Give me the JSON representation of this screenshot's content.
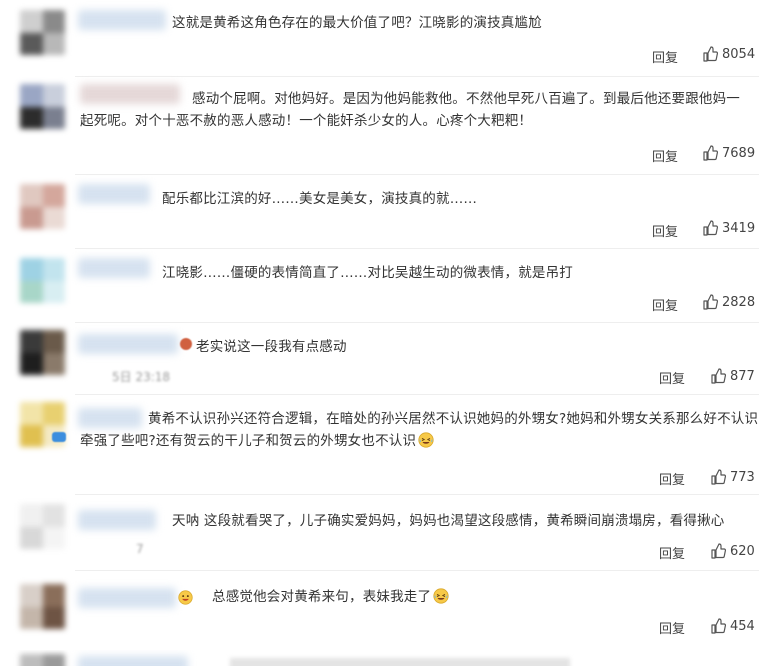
{
  "comments": [
    {
      "text": "这就是黄希这角色存在的最大价值了吧？江晓影的演技真尴尬",
      "reply_label": "回复",
      "likes": "8054"
    },
    {
      "text": "感动个屁啊。对他妈好。是因为他妈能救他。不然他早死八百遍了。到最后他还要跟他妈一起死呢。对个十恶不赦的恶人感动！一个能奸杀少女的人。心疼个大粑粑！",
      "reply_label": "回复",
      "likes": "7689"
    },
    {
      "text": "配乐都比江滨的好……美女是美女，演技真的就……",
      "reply_label": "回复",
      "likes": "3419"
    },
    {
      "text": "江晓影……僵硬的表情简直了……对比吴越生动的微表情，就是吊打",
      "reply_label": "回复",
      "likes": "2828"
    },
    {
      "text": "老实说这一段我有点感动",
      "time": "5日 23:18",
      "reply_label": "回复",
      "likes": "877"
    },
    {
      "text": "黄希不认识孙兴还符合逻辑，在暗处的孙兴居然不认识她妈的外甥女?她妈和外甥女关系那么好不认识牵强了些吧?还有贺云的干儿子和贺云的外甥女也不认识",
      "reply_label": "回复",
      "likes": "773"
    },
    {
      "text": "天呐 这段就看哭了，儿子确实爱妈妈，妈妈也渴望这段感情，黄希瞬间崩溃塌房，看得揪心",
      "time": "7",
      "reply_label": "回复",
      "likes": "620"
    },
    {
      "text": "总感觉他会对黄希来句，表妹我走了",
      "reply_label": "回复",
      "likes": "454"
    }
  ],
  "icons": {
    "like": "thumbs-up-icon",
    "laugh_emoji": "laughing-tears-emoji-icon",
    "grin_emoji": "grinning-emoji-icon"
  },
  "colors": {
    "text": "#333333",
    "meta": "#444444",
    "nickname_blur": "#d6e2f0"
  }
}
